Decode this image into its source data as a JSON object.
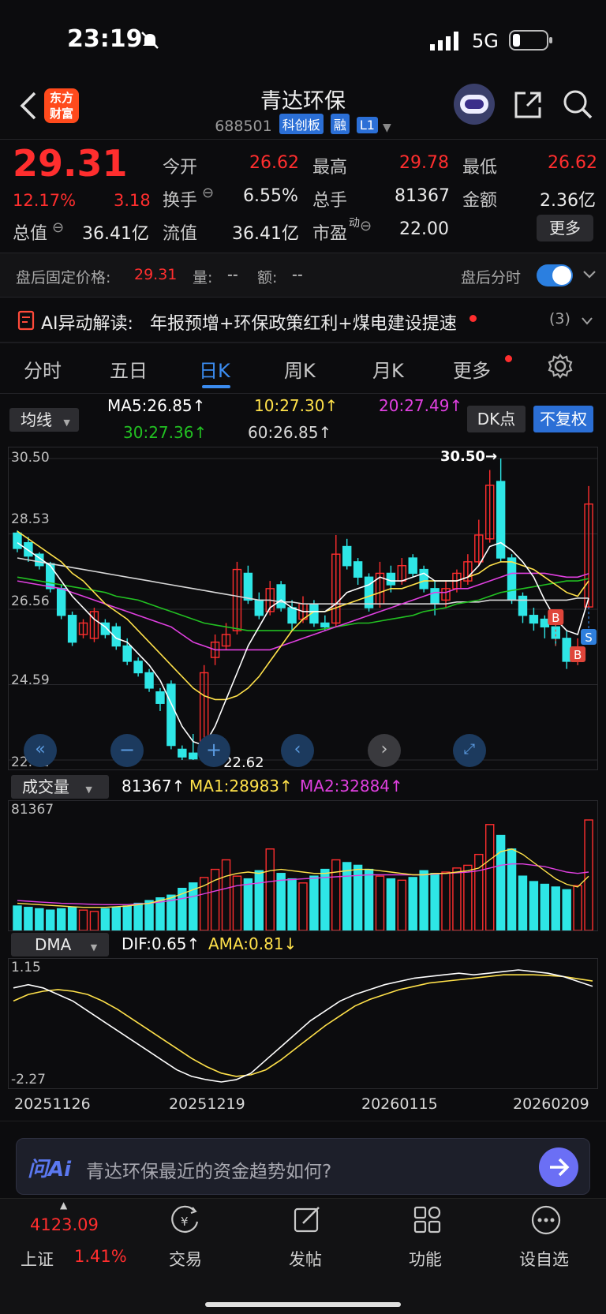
{
  "status_bar": {
    "time": "23:19",
    "network": "5G"
  },
  "header": {
    "title": "青达环保",
    "code": "688501",
    "tags": [
      "科创板",
      "融",
      "L1"
    ],
    "badge": [
      "东方",
      "财富"
    ]
  },
  "quote": {
    "price": "29.31",
    "change_pct": "12.17%",
    "change": "3.18",
    "labels": {
      "open": "今开",
      "high": "最高",
      "low": "最低",
      "turnover": "换手",
      "volume": "总手",
      "amount": "金额",
      "mktcap": "总值",
      "float_cap": "流值",
      "pe": "市盈",
      "pe_sup": "动"
    },
    "open": "26.62",
    "high": "29.78",
    "low": "26.62",
    "turnover": "6.55%",
    "volume": "81367",
    "amount": "2.36亿",
    "mktcap": "36.41亿",
    "float_cap": "36.41亿",
    "pe": "22.00",
    "more_label": "更多"
  },
  "after_hours": {
    "label": "盘后固定价格:",
    "price": "29.31",
    "vol_label": "量:",
    "vol": "--",
    "amt_label": "额:",
    "amt": "--",
    "toggle_label": "盘后分时"
  },
  "ai_bar": {
    "title": "AI异动解读:",
    "text": "年报预增+环保政策红利+煤电建设提速",
    "count": "(3)"
  },
  "tabs": [
    "分时",
    "五日",
    "日K",
    "周K",
    "月K",
    "更多"
  ],
  "active_tab": "日K",
  "kline_indicators": {
    "selector": "均线",
    "ma5": "MA5:26.85↑",
    "ma10": "10:27.30↑",
    "ma20": "20:27.49↑",
    "ma30": "30:27.36↑",
    "ma60": "60:26.85↑",
    "dk_button": "DK点",
    "fq_button": "不复权"
  },
  "volume_indicators": {
    "selector": "成交量",
    "vol": "81367↑",
    "ma1": "MA1:28983↑",
    "ma2": "MA2:32884↑",
    "axis_max": "81367"
  },
  "dma_indicators": {
    "selector": "DMA",
    "dif": "DIF:0.65↑",
    "ama": "AMA:0.81↓",
    "axis_max": "1.15",
    "axis_min": "-2.27"
  },
  "chart_data": {
    "type": "candlestick",
    "y_ticks": [
      "30.50",
      "28.53",
      "26.56",
      "24.59",
      "22.62"
    ],
    "ylim": [
      22.62,
      30.5
    ],
    "max_annotation": "30.50",
    "min_annotation": "22.62",
    "x_labels": [
      "20251126",
      "20251219",
      "20260115",
      "20260209"
    ],
    "candles": [
      {
        "o": 28.55,
        "c": 28.15,
        "h": 28.62,
        "l": 28.05
      },
      {
        "o": 28.3,
        "c": 27.95,
        "h": 28.45,
        "l": 27.8
      },
      {
        "o": 28.0,
        "c": 27.7,
        "h": 28.05,
        "l": 27.6
      },
      {
        "o": 27.75,
        "c": 27.1,
        "h": 27.8,
        "l": 27.0
      },
      {
        "o": 27.1,
        "c": 26.4,
        "h": 27.2,
        "l": 26.3
      },
      {
        "o": 26.4,
        "c": 25.7,
        "h": 26.5,
        "l": 25.6
      },
      {
        "o": 25.9,
        "c": 26.2,
        "h": 26.3,
        "l": 25.8
      },
      {
        "o": 25.8,
        "c": 26.5,
        "h": 26.6,
        "l": 25.7
      },
      {
        "o": 26.2,
        "c": 25.9,
        "h": 26.3,
        "l": 25.8
      },
      {
        "o": 26.1,
        "c": 25.6,
        "h": 26.2,
        "l": 25.5
      },
      {
        "o": 25.6,
        "c": 25.2,
        "h": 25.8,
        "l": 25.1
      },
      {
        "o": 25.2,
        "c": 24.9,
        "h": 25.3,
        "l": 24.8
      },
      {
        "o": 24.9,
        "c": 24.5,
        "h": 25.0,
        "l": 24.4
      },
      {
        "o": 24.4,
        "c": 24.1,
        "h": 24.5,
        "l": 23.9
      },
      {
        "o": 24.6,
        "c": 23.0,
        "h": 24.7,
        "l": 22.9
      },
      {
        "o": 22.9,
        "c": 22.7,
        "h": 23.0,
        "l": 22.62
      },
      {
        "o": 22.8,
        "c": 22.65,
        "h": 23.3,
        "l": 22.62
      },
      {
        "o": 22.9,
        "c": 24.9,
        "h": 25.1,
        "l": 22.8
      },
      {
        "o": 25.3,
        "c": 25.7,
        "h": 25.9,
        "l": 25.1
      },
      {
        "o": 25.6,
        "c": 25.9,
        "h": 26.2,
        "l": 25.5
      },
      {
        "o": 26.0,
        "c": 27.6,
        "h": 27.8,
        "l": 25.9
      },
      {
        "o": 27.5,
        "c": 26.8,
        "h": 27.7,
        "l": 26.7
      },
      {
        "o": 26.8,
        "c": 26.4,
        "h": 27.0,
        "l": 26.3
      },
      {
        "o": 26.5,
        "c": 27.1,
        "h": 27.3,
        "l": 26.4
      },
      {
        "o": 27.2,
        "c": 26.6,
        "h": 27.3,
        "l": 26.5
      },
      {
        "o": 26.6,
        "c": 26.2,
        "h": 26.8,
        "l": 26.0
      },
      {
        "o": 26.3,
        "c": 26.7,
        "h": 26.9,
        "l": 26.2
      },
      {
        "o": 26.7,
        "c": 26.2,
        "h": 26.8,
        "l": 26.1
      },
      {
        "o": 26.2,
        "c": 26.1,
        "h": 26.4,
        "l": 26.0
      },
      {
        "o": 26.2,
        "c": 28.0,
        "h": 28.5,
        "l": 26.1
      },
      {
        "o": 28.2,
        "c": 27.7,
        "h": 28.4,
        "l": 27.6
      },
      {
        "o": 27.8,
        "c": 27.4,
        "h": 27.9,
        "l": 27.2
      },
      {
        "o": 27.4,
        "c": 26.6,
        "h": 27.5,
        "l": 26.5
      },
      {
        "o": 26.7,
        "c": 27.5,
        "h": 27.8,
        "l": 26.6
      },
      {
        "o": 27.5,
        "c": 27.2,
        "h": 27.7,
        "l": 27.0
      },
      {
        "o": 27.3,
        "c": 27.7,
        "h": 27.9,
        "l": 27.2
      },
      {
        "o": 27.9,
        "c": 27.5,
        "h": 28.0,
        "l": 27.4
      },
      {
        "o": 27.6,
        "c": 27.1,
        "h": 27.7,
        "l": 27.0
      },
      {
        "o": 27.1,
        "c": 26.7,
        "h": 27.3,
        "l": 26.4
      },
      {
        "o": 26.8,
        "c": 27.1,
        "h": 27.3,
        "l": 26.6
      },
      {
        "o": 27.1,
        "c": 27.5,
        "h": 27.6,
        "l": 27.0
      },
      {
        "o": 27.3,
        "c": 27.8,
        "h": 28.0,
        "l": 27.2
      },
      {
        "o": 27.8,
        "c": 28.5,
        "h": 28.9,
        "l": 27.7
      },
      {
        "o": 28.4,
        "c": 29.8,
        "h": 30.2,
        "l": 28.3
      },
      {
        "o": 29.9,
        "c": 27.9,
        "h": 30.5,
        "l": 27.8
      },
      {
        "o": 27.9,
        "c": 26.8,
        "h": 28.0,
        "l": 26.7
      },
      {
        "o": 26.9,
        "c": 26.4,
        "h": 27.0,
        "l": 26.2
      },
      {
        "o": 26.4,
        "c": 26.2,
        "h": 26.6,
        "l": 26.0
      },
      {
        "o": 26.3,
        "c": 26.1,
        "h": 26.4,
        "l": 25.8
      },
      {
        "o": 26.1,
        "c": 25.8,
        "h": 26.3,
        "l": 25.6
      },
      {
        "o": 25.8,
        "c": 25.2,
        "h": 26.0,
        "l": 25.0
      },
      {
        "o": 25.3,
        "c": 25.5,
        "h": 25.8,
        "l": 25.1
      },
      {
        "o": 26.62,
        "c": 29.31,
        "h": 29.78,
        "l": 26.62
      }
    ],
    "ma5": [
      28.3,
      28.1,
      27.9,
      27.7,
      27.3,
      26.9,
      26.6,
      26.3,
      26.1,
      25.8,
      25.7,
      25.4,
      25.1,
      24.7,
      24.1,
      23.5,
      23.1,
      23.0,
      23.5,
      24.2,
      24.9,
      25.6,
      26.1,
      26.6,
      26.8,
      26.6,
      26.5,
      26.5,
      26.5,
      26.7,
      27.0,
      27.1,
      27.2,
      27.4,
      27.3,
      27.3,
      27.4,
      27.5,
      27.3,
      27.3,
      27.3,
      27.4,
      27.7,
      28.2,
      28.3,
      28.1,
      27.8,
      27.4,
      26.8,
      26.3,
      26.0,
      25.9,
      26.85
    ],
    "ma10": [
      28.6,
      28.4,
      28.2,
      28.0,
      27.8,
      27.5,
      27.3,
      27.0,
      26.7,
      26.5,
      26.3,
      26.0,
      25.7,
      25.4,
      25.1,
      24.8,
      24.5,
      24.3,
      24.2,
      24.2,
      24.3,
      24.5,
      24.8,
      25.2,
      25.6,
      26.0,
      26.3,
      26.5,
      26.5,
      26.6,
      26.7,
      26.8,
      26.9,
      27.0,
      27.1,
      27.1,
      27.2,
      27.3,
      27.3,
      27.3,
      27.3,
      27.4,
      27.5,
      27.7,
      27.8,
      27.8,
      27.7,
      27.6,
      27.4,
      27.2,
      27.0,
      26.9,
      27.3
    ],
    "ma20": [
      27.3,
      27.25,
      27.2,
      27.15,
      27.1,
      27.0,
      26.9,
      26.8,
      26.7,
      26.6,
      26.5,
      26.4,
      26.3,
      26.2,
      26.1,
      25.9,
      25.7,
      25.6,
      25.5,
      25.5,
      25.5,
      25.5,
      25.5,
      25.5,
      25.6,
      25.7,
      25.8,
      25.9,
      26.0,
      26.1,
      26.2,
      26.3,
      26.4,
      26.5,
      26.6,
      26.7,
      26.8,
      26.9,
      27.0,
      27.0,
      27.1,
      27.1,
      27.2,
      27.3,
      27.4,
      27.5,
      27.5,
      27.5,
      27.5,
      27.45,
      27.4,
      27.4,
      27.49
    ],
    "ma30": [
      27.4,
      27.35,
      27.3,
      27.25,
      27.2,
      27.15,
      27.1,
      27.05,
      27.0,
      26.9,
      26.85,
      26.8,
      26.7,
      26.6,
      26.5,
      26.4,
      26.3,
      26.2,
      26.15,
      26.1,
      26.05,
      26.0,
      26.0,
      26.0,
      26.0,
      26.0,
      26.0,
      26.0,
      26.05,
      26.1,
      26.15,
      26.2,
      26.2,
      26.25,
      26.3,
      26.35,
      26.4,
      26.5,
      26.55,
      26.6,
      26.7,
      26.75,
      26.8,
      26.9,
      27.0,
      27.05,
      27.1,
      27.15,
      27.2,
      27.25,
      27.3,
      27.3,
      27.36
    ],
    "ma60": [
      27.9,
      27.85,
      27.8,
      27.75,
      27.7,
      27.65,
      27.6,
      27.55,
      27.5,
      27.45,
      27.4,
      27.35,
      27.3,
      27.25,
      27.2,
      27.15,
      27.1,
      27.05,
      27.0,
      26.95,
      26.9,
      26.85,
      26.8,
      26.8,
      26.75,
      26.75,
      26.7,
      26.7,
      26.7,
      26.7,
      26.7,
      26.7,
      26.7,
      26.7,
      26.7,
      26.7,
      26.7,
      26.7,
      26.7,
      26.7,
      26.75,
      26.75,
      26.75,
      26.8,
      26.8,
      26.8,
      26.8,
      26.8,
      26.8,
      26.8,
      26.8,
      26.85,
      26.85
    ],
    "signals": [
      {
        "label": "B",
        "index": 49,
        "color": "#e0453a"
      },
      {
        "label": "B",
        "index": 51,
        "color": "#e0453a"
      },
      {
        "label": "S",
        "index": 52,
        "color": "#2f7fdd"
      }
    ],
    "volume": [
      18000,
      17000,
      16000,
      15000,
      16000,
      17000,
      15000,
      14000,
      16000,
      17000,
      18000,
      20000,
      22000,
      24000,
      26000,
      31000,
      35000,
      39000,
      45000,
      52000,
      40000,
      38000,
      44000,
      60000,
      42000,
      38000,
      35000,
      40000,
      45000,
      52000,
      50000,
      48000,
      45000,
      40000,
      38000,
      37000,
      39000,
      44000,
      42000,
      43000,
      46000,
      48000,
      56000,
      78000,
      70000,
      60000,
      40000,
      36000,
      34000,
      32000,
      30000,
      33000,
      81367
    ],
    "vol_ma1": [
      20000,
      19500,
      19000,
      18500,
      18000,
      17500,
      17000,
      17000,
      17000,
      17500,
      18000,
      19000,
      20000,
      22000,
      24000,
      27000,
      30000,
      33000,
      37000,
      40000,
      42000,
      43000,
      42000,
      44000,
      45000,
      44000,
      43000,
      42000,
      42000,
      43000,
      44000,
      45000,
      45000,
      44000,
      43000,
      42000,
      41000,
      41000,
      42000,
      42000,
      43000,
      44000,
      46000,
      52000,
      58000,
      60000,
      56000,
      50000,
      44000,
      38000,
      34000,
      32000,
      40000
    ],
    "vol_ma2": [
      22000,
      21500,
      21000,
      20500,
      20000,
      19800,
      19500,
      19200,
      19000,
      19000,
      19000,
      19500,
      20000,
      21000,
      22000,
      23500,
      25000,
      27000,
      29000,
      31000,
      33000,
      34000,
      35000,
      36000,
      37000,
      37500,
      38000,
      38500,
      39000,
      39500,
      40000,
      40500,
      41000,
      41000,
      41000,
      41000,
      41000,
      41000,
      41500,
      42000,
      42500,
      43000,
      44000,
      46000,
      48000,
      49000,
      49000,
      48000,
      47000,
      45000,
      43000,
      42000,
      43000
    ],
    "dif": [
      0.6,
      0.7,
      0.6,
      0.4,
      0.2,
      -0.1,
      -0.4,
      -0.7,
      -1.0,
      -1.3,
      -1.6,
      -1.9,
      -2.1,
      -2.2,
      -2.27,
      -2.2,
      -2.0,
      -1.6,
      -1.2,
      -0.8,
      -0.4,
      -0.1,
      0.2,
      0.4,
      0.55,
      0.7,
      0.8,
      0.9,
      0.95,
      1.0,
      1.05,
      1.0,
      1.05,
      1.1,
      1.15,
      1.1,
      1.05,
      0.95,
      0.8,
      0.65
    ],
    "ama": [
      0.2,
      0.4,
      0.5,
      0.55,
      0.5,
      0.4,
      0.2,
      -0.05,
      -0.35,
      -0.65,
      -0.95,
      -1.25,
      -1.55,
      -1.8,
      -2.0,
      -2.1,
      -2.05,
      -1.9,
      -1.6,
      -1.25,
      -0.9,
      -0.55,
      -0.25,
      0.05,
      0.25,
      0.4,
      0.55,
      0.65,
      0.75,
      0.8,
      0.85,
      0.9,
      0.95,
      1.0,
      1.0,
      1.0,
      0.98,
      0.95,
      0.88,
      0.81
    ]
  },
  "ask_ai": {
    "logo": "问Ai",
    "placeholder": "青达环保最近的资金趋势如何?"
  },
  "bottom_nav": {
    "index_value": "4123.09",
    "index_name": "上证",
    "index_pct": "1.41%",
    "items": [
      "交易",
      "发帖",
      "功能",
      "设自选"
    ]
  },
  "colors": {
    "up": "#ff2e2e",
    "down": "#2ee6e6",
    "ma5": "#ffffff",
    "ma10": "#ffe14a",
    "ma20": "#e040e0",
    "ma30": "#22c022",
    "ma60": "#d8d8d8",
    "accent": "#2b6fd6"
  }
}
